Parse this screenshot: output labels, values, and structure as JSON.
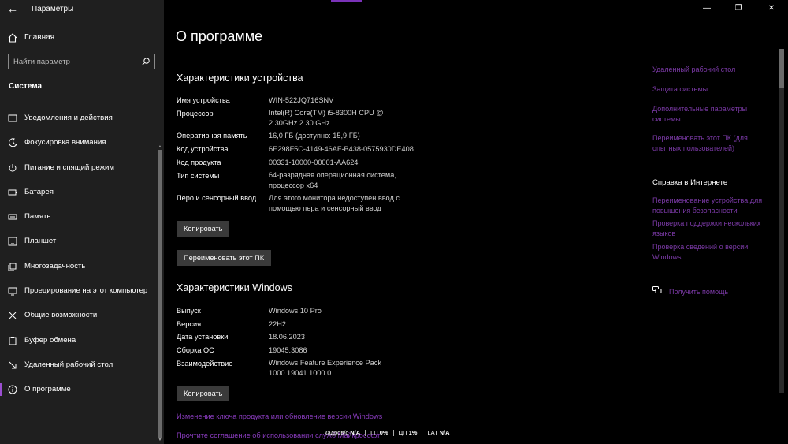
{
  "window": {
    "title": "Параметры",
    "controls": {
      "minimize": "—",
      "maximize": "❐",
      "close": "✕"
    }
  },
  "sidebar": {
    "home_label": "Главная",
    "search_placeholder": "Найти параметр",
    "section_title": "Система",
    "items": [
      {
        "label": "Уведомления и действия",
        "icon": "notification-icon"
      },
      {
        "label": "Фокусировка внимания",
        "icon": "moon-icon"
      },
      {
        "label": "Питание и спящий режим",
        "icon": "power-icon"
      },
      {
        "label": "Батарея",
        "icon": "battery-icon"
      },
      {
        "label": "Память",
        "icon": "storage-icon"
      },
      {
        "label": "Планшет",
        "icon": "tablet-icon"
      },
      {
        "label": "Многозадачность",
        "icon": "multitask-icon"
      },
      {
        "label": "Проецирование на этот компьютер",
        "icon": "projection-icon"
      },
      {
        "label": "Общие возможности",
        "icon": "shared-icon"
      },
      {
        "label": "Буфер обмена",
        "icon": "clipboard-icon"
      },
      {
        "label": "Удаленный рабочий стол",
        "icon": "remote-icon"
      },
      {
        "label": "О программе",
        "icon": "info-icon",
        "active": true
      }
    ]
  },
  "main": {
    "page_title": "О программе",
    "device_section": {
      "title": "Характеристики устройства",
      "rows": [
        {
          "label": "Имя устройства",
          "value": "WIN-522JQ716SNV"
        },
        {
          "label": "Процессор",
          "value": "Intel(R) Core(TM) i5-8300H CPU @ 2.30GHz   2.30 GHz"
        },
        {
          "label": "Оперативная память",
          "value": "16,0 ГБ (доступно: 15,9 ГБ)"
        },
        {
          "label": "Код устройства",
          "value": "6E298F5C-4149-46AF-B438-0575930DE408"
        },
        {
          "label": "Код продукта",
          "value": "00331-10000-00001-AA624"
        },
        {
          "label": "Тип системы",
          "value": "64-разрядная операционная система, процессор x64"
        },
        {
          "label": "Перо и сенсорный ввод",
          "value": "Для этого монитора недоступен ввод с помощью пера и сенсорный ввод"
        }
      ],
      "copy_button": "Копировать",
      "rename_button": "Переименовать этот ПК"
    },
    "windows_section": {
      "title": "Характеристики Windows",
      "rows": [
        {
          "label": "Выпуск",
          "value": "Windows 10 Pro"
        },
        {
          "label": "Версия",
          "value": "22H2"
        },
        {
          "label": "Дата установки",
          "value": "18.06.2023"
        },
        {
          "label": "Сборка ОС",
          "value": "19045.3086"
        },
        {
          "label": "Взаимодействие",
          "value": "Windows Feature Experience Pack 1000.19041.1000.0"
        }
      ],
      "copy_button": "Копировать",
      "link_change_key": "Изменение ключа продукта или обновление версии Windows",
      "link_agreement": "Прочтите соглашение об использовании служб Майкрософт"
    }
  },
  "right_panel": {
    "links_top": [
      "Удаленный рабочий стол",
      "Защита системы",
      "Дополнительные параметры системы",
      "Переименовать этот ПК (для опытных пользователей)"
    ],
    "help_title": "Справка в Интернете",
    "help_links": [
      "Переименование устройства для повышения безопасности",
      "Проверка поддержки нескольких языков",
      "Проверка сведений о версии Windows"
    ],
    "get_help": "Получить помощь"
  },
  "overlay": {
    "fps_label": "кадров/с",
    "fps_value": "N/A",
    "gpu_label": "ГП",
    "gpu_value": "0%",
    "cpu_label": "ЦП",
    "cpu_value": "1%",
    "lat_label": "LAT",
    "lat_value": "N/A"
  },
  "colors": {
    "accent": "#8a3cbf",
    "sidebar_bg": "#1f1f1f",
    "main_bg": "#000000"
  }
}
